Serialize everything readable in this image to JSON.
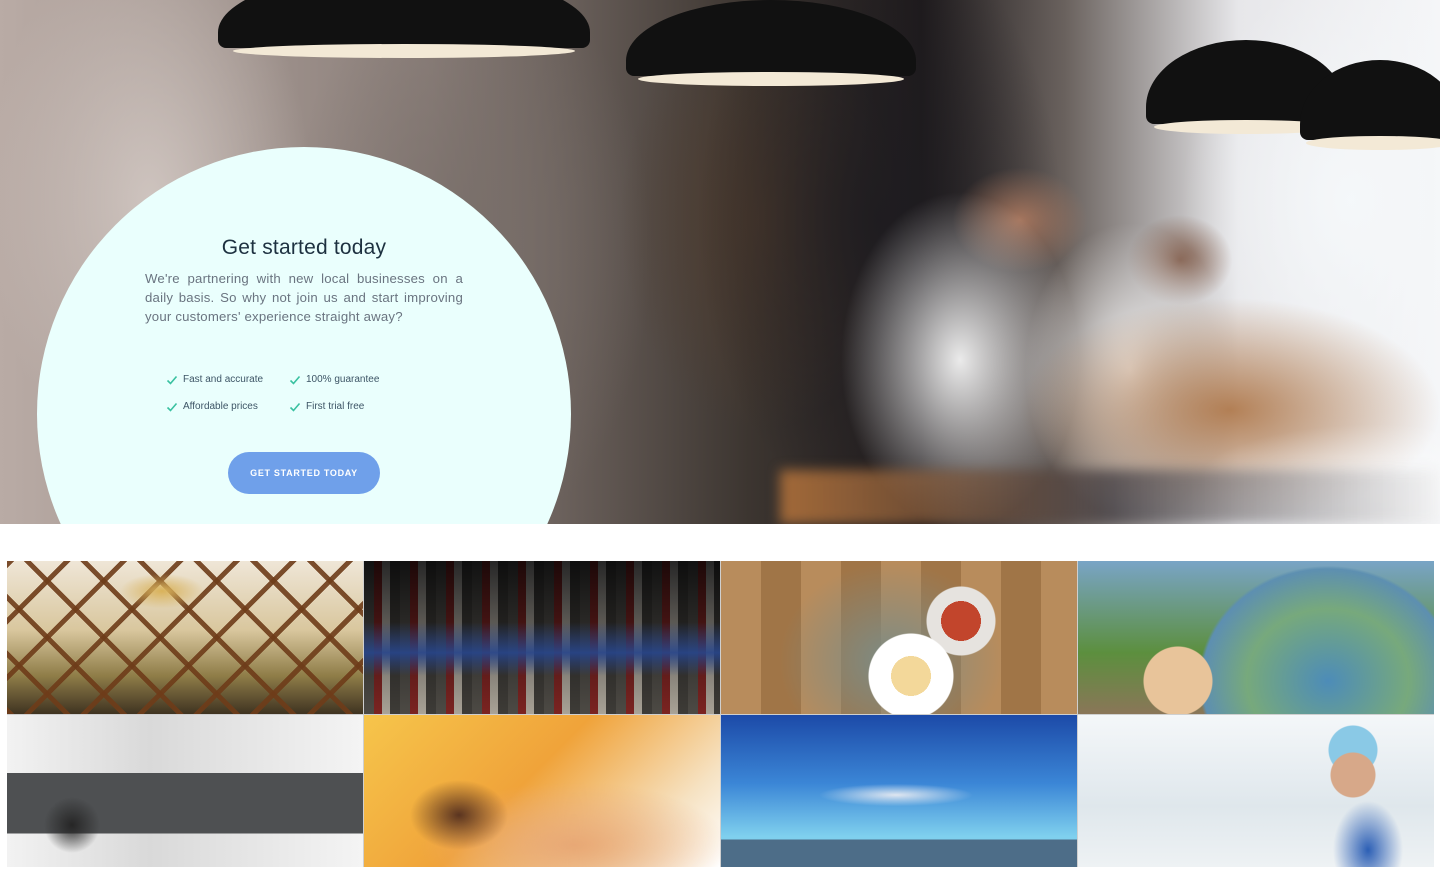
{
  "hero": {
    "title": "Get started today",
    "body": "We're partnering with new local businesses on a daily basis. So why not join us and start improving your customers' experience straight away?",
    "features": [
      "Fast and accurate",
      "100% guarantee",
      "Affordable prices",
      "First trial free"
    ],
    "cta_label": "GET STARTED TODAY",
    "accent_color": "#6fa0ea",
    "check_color": "#39c1a0",
    "card_color": "#eafffd"
  },
  "gallery": {
    "tiles": [
      "hotel-lobby-photo",
      "clothing-store-photo",
      "restaurant-food-photo",
      "globe-travel-photo",
      "living-room-sofa-photo",
      "spa-massage-photo",
      "airplane-photo",
      "doctor-dentist-photo"
    ]
  }
}
